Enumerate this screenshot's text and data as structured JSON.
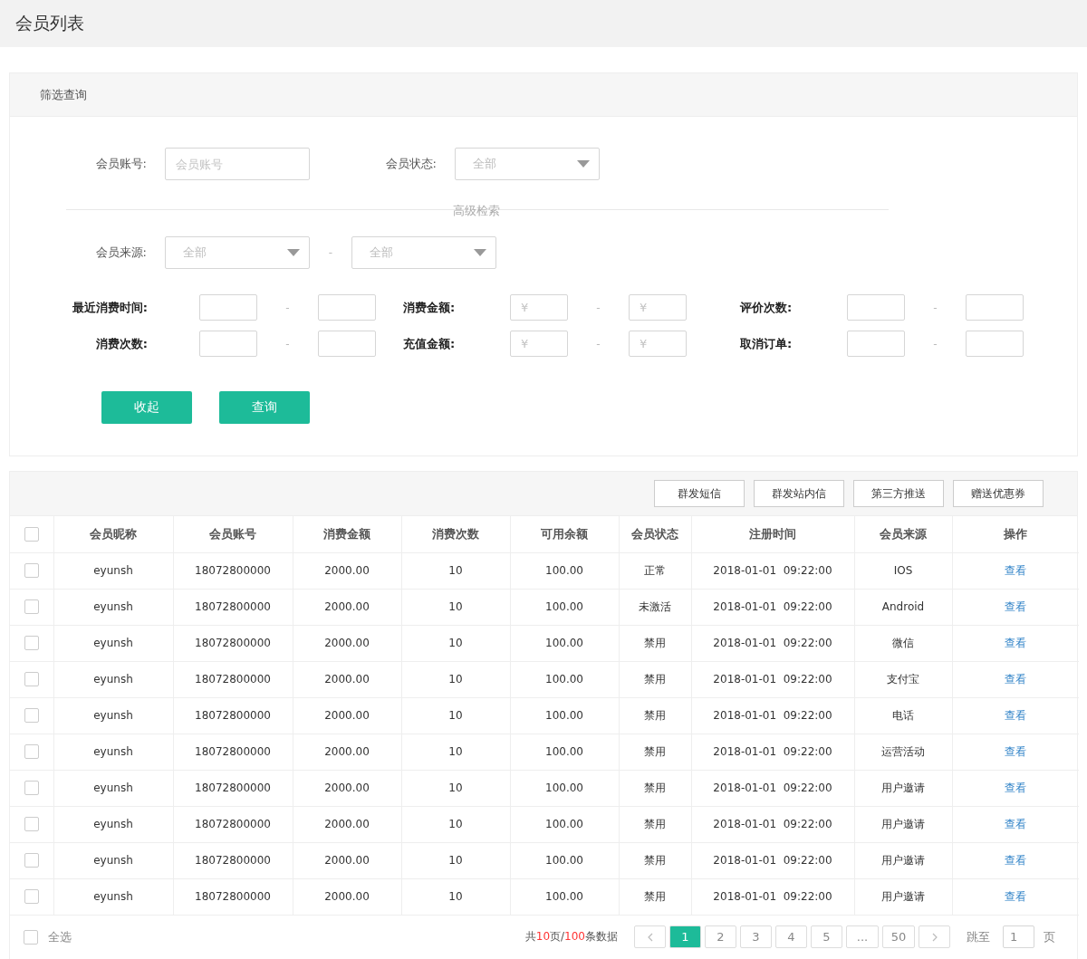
{
  "page_title": "会员列表",
  "filter": {
    "title": "筛选查询",
    "basic": [
      {
        "kind": "input",
        "label": "会员账号:",
        "placeholder": "会员账号"
      },
      {
        "kind": "select",
        "label": "会员状态:",
        "value": "全部"
      }
    ],
    "advanced_label": "高级检索",
    "source": {
      "label": "会员来源:",
      "from": "全部",
      "dash": "-",
      "to": "全部"
    },
    "ranges": [
      {
        "label": "最近消费时间:",
        "dash": "-"
      },
      {
        "label": "消费金额:",
        "placeholder": "¥",
        "dash": "-"
      },
      {
        "label": "评价次数:",
        "dash": "-"
      },
      {
        "label": "消费次数:",
        "dash": "-"
      },
      {
        "label": "充值金额:",
        "placeholder": "¥",
        "dash": "-"
      },
      {
        "label": "取消订单:",
        "dash": "-"
      }
    ],
    "buttons": [
      "收起",
      "查询"
    ]
  },
  "actions": [
    "群发短信",
    "群发站内信",
    "第三方推送",
    "赠送优惠券"
  ],
  "table": {
    "columns": [
      "会员昵称",
      "会员账号",
      "消费金额",
      "消费次数",
      "可用余额",
      "会员状态",
      "注册时间",
      "会员来源",
      "操作"
    ],
    "header_checked": false,
    "rows": [
      {
        "checked": false,
        "cells": [
          "eyunsh",
          "18072800000",
          "2000.00",
          "10",
          "100.00",
          "正常",
          "2018-01-01  09:22:00",
          "IOS"
        ],
        "action": "查看"
      },
      {
        "checked": false,
        "cells": [
          "eyunsh",
          "18072800000",
          "2000.00",
          "10",
          "100.00",
          "未激活",
          "2018-01-01  09:22:00",
          "Android"
        ],
        "action": "查看"
      },
      {
        "checked": false,
        "cells": [
          "eyunsh",
          "18072800000",
          "2000.00",
          "10",
          "100.00",
          "禁用",
          "2018-01-01  09:22:00",
          "微信"
        ],
        "action": "查看"
      },
      {
        "checked": false,
        "cells": [
          "eyunsh",
          "18072800000",
          "2000.00",
          "10",
          "100.00",
          "禁用",
          "2018-01-01  09:22:00",
          "支付宝"
        ],
        "action": "查看"
      },
      {
        "checked": false,
        "cells": [
          "eyunsh",
          "18072800000",
          "2000.00",
          "10",
          "100.00",
          "禁用",
          "2018-01-01  09:22:00",
          "电话"
        ],
        "action": "查看"
      },
      {
        "checked": false,
        "cells": [
          "eyunsh",
          "18072800000",
          "2000.00",
          "10",
          "100.00",
          "禁用",
          "2018-01-01  09:22:00",
          "运营活动"
        ],
        "action": "查看"
      },
      {
        "checked": false,
        "cells": [
          "eyunsh",
          "18072800000",
          "2000.00",
          "10",
          "100.00",
          "禁用",
          "2018-01-01  09:22:00",
          "用户邀请"
        ],
        "action": "查看"
      },
      {
        "checked": false,
        "cells": [
          "eyunsh",
          "18072800000",
          "2000.00",
          "10",
          "100.00",
          "禁用",
          "2018-01-01  09:22:00",
          "用户邀请"
        ],
        "action": "查看"
      },
      {
        "checked": false,
        "cells": [
          "eyunsh",
          "18072800000",
          "2000.00",
          "10",
          "100.00",
          "禁用",
          "2018-01-01  09:22:00",
          "用户邀请"
        ],
        "action": "查看"
      },
      {
        "checked": false,
        "cells": [
          "eyunsh",
          "18072800000",
          "2000.00",
          "10",
          "100.00",
          "禁用",
          "2018-01-01  09:22:00",
          "用户邀请"
        ],
        "action": "查看"
      }
    ]
  },
  "footer": {
    "select_all": {
      "label": "全选",
      "checked": false
    },
    "summary": {
      "prefix": "共",
      "pages": "10",
      "middle": "页/",
      "total": "100",
      "suffix": "条数据"
    },
    "pages": [
      {
        "label": "1",
        "selected": true
      },
      {
        "label": "2",
        "selected": false
      },
      {
        "label": "3",
        "selected": false
      },
      {
        "label": "4",
        "selected": false
      },
      {
        "label": "5",
        "selected": false
      },
      {
        "label": "...",
        "selected": false
      },
      {
        "label": "50",
        "selected": false
      }
    ],
    "jump_label": "跳至",
    "jump_value": "1",
    "page_unit": "页"
  }
}
